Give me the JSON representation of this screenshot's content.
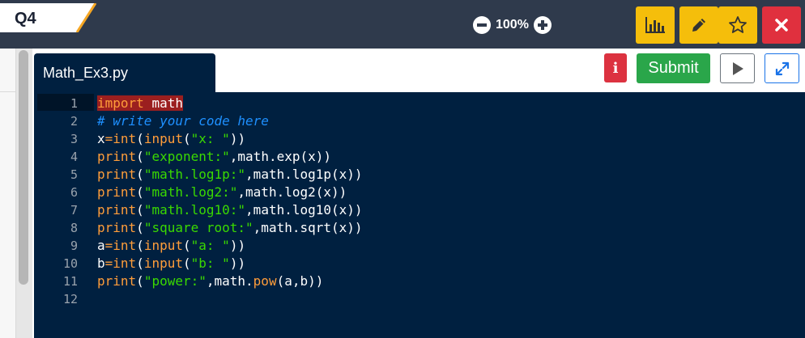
{
  "header": {
    "question_tab": "Q4",
    "zoom_level": "100%"
  },
  "toolbar": {
    "stats_icon": "bar-chart-icon",
    "edit_icon": "pencil-icon",
    "favorite_icon": "star-icon",
    "close_icon": "close-icon",
    "colors": {
      "yellow": "#f5be0b",
      "red": "#e0303e",
      "bar": "#2f3a4c"
    }
  },
  "editor": {
    "file_name": "Math_Ex3.py",
    "info_label": "i",
    "submit_label": "Submit",
    "line_numbers": [
      "1",
      "2",
      "3",
      "4",
      "5",
      "6",
      "7",
      "8",
      "9",
      "10",
      "11",
      "12"
    ],
    "lines": [
      {
        "parts": [
          {
            "t": "import",
            "c": "kw hl"
          },
          {
            "t": " ",
            "c": "pl hl"
          },
          {
            "t": "math",
            "c": "pl hl"
          }
        ]
      },
      {
        "parts": [
          {
            "t": "# write your code here",
            "c": "cm"
          }
        ]
      },
      {
        "parts": [
          {
            "t": "x",
            "c": "pl"
          },
          {
            "t": "=",
            "c": "kw"
          },
          {
            "t": "int",
            "c": "fn"
          },
          {
            "t": "(",
            "c": "pl"
          },
          {
            "t": "input",
            "c": "fn"
          },
          {
            "t": "(",
            "c": "pl"
          },
          {
            "t": "\"x: \"",
            "c": "str"
          },
          {
            "t": "))",
            "c": "pl"
          }
        ]
      },
      {
        "parts": [
          {
            "t": "print",
            "c": "fn"
          },
          {
            "t": "(",
            "c": "pl"
          },
          {
            "t": "\"exponent:\"",
            "c": "str"
          },
          {
            "t": ",math.exp(x))",
            "c": "pl"
          }
        ]
      },
      {
        "parts": [
          {
            "t": "print",
            "c": "fn"
          },
          {
            "t": "(",
            "c": "pl"
          },
          {
            "t": "\"math.log1p:\"",
            "c": "str"
          },
          {
            "t": ",math.log1p(x))",
            "c": "pl"
          }
        ]
      },
      {
        "parts": [
          {
            "t": "print",
            "c": "fn"
          },
          {
            "t": "(",
            "c": "pl"
          },
          {
            "t": "\"math.log2:\"",
            "c": "str"
          },
          {
            "t": ",math.log2(x))",
            "c": "pl"
          }
        ]
      },
      {
        "parts": [
          {
            "t": "print",
            "c": "fn"
          },
          {
            "t": "(",
            "c": "pl"
          },
          {
            "t": "\"math.log10:\"",
            "c": "str"
          },
          {
            "t": ",math.log10(x))",
            "c": "pl"
          }
        ]
      },
      {
        "parts": [
          {
            "t": "print",
            "c": "fn"
          },
          {
            "t": "(",
            "c": "pl"
          },
          {
            "t": "\"square root:\"",
            "c": "str"
          },
          {
            "t": ",math.sqrt(x))",
            "c": "pl"
          }
        ]
      },
      {
        "parts": [
          {
            "t": "a",
            "c": "pl"
          },
          {
            "t": "=",
            "c": "kw"
          },
          {
            "t": "int",
            "c": "fn"
          },
          {
            "t": "(",
            "c": "pl"
          },
          {
            "t": "input",
            "c": "fn"
          },
          {
            "t": "(",
            "c": "pl"
          },
          {
            "t": "\"a: \"",
            "c": "str"
          },
          {
            "t": "))",
            "c": "pl"
          }
        ]
      },
      {
        "parts": [
          {
            "t": "b",
            "c": "pl"
          },
          {
            "t": "=",
            "c": "kw"
          },
          {
            "t": "int",
            "c": "fn"
          },
          {
            "t": "(",
            "c": "pl"
          },
          {
            "t": "input",
            "c": "fn"
          },
          {
            "t": "(",
            "c": "pl"
          },
          {
            "t": "\"b: \"",
            "c": "str"
          },
          {
            "t": "))",
            "c": "pl"
          }
        ]
      },
      {
        "parts": [
          {
            "t": "print",
            "c": "fn"
          },
          {
            "t": "(",
            "c": "pl"
          },
          {
            "t": "\"power:\"",
            "c": "str"
          },
          {
            "t": ",math.",
            "c": "pl"
          },
          {
            "t": "pow",
            "c": "fn"
          },
          {
            "t": "(a,b))",
            "c": "pl"
          }
        ]
      },
      {
        "parts": []
      }
    ]
  }
}
